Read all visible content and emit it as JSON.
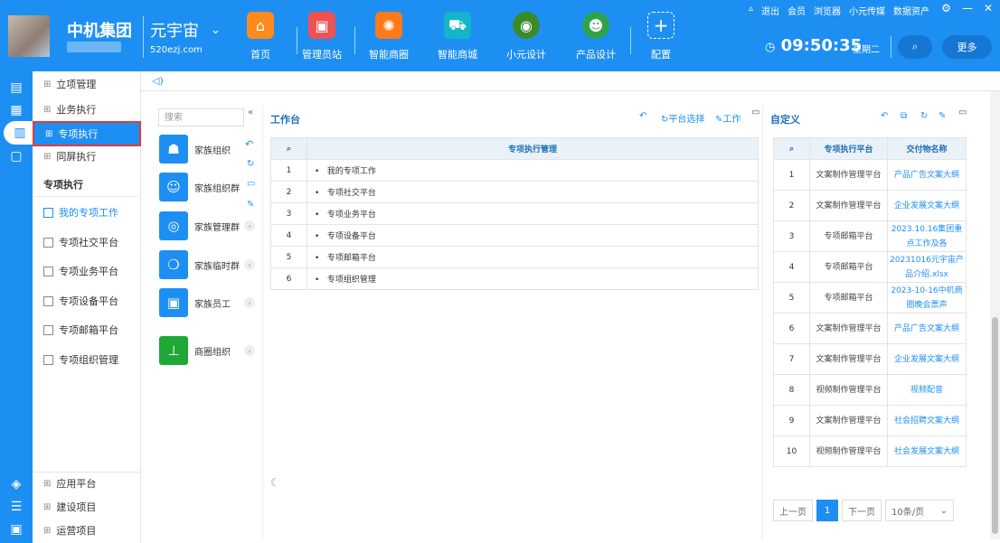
{
  "header": {
    "org_name": "中机集团",
    "brand_name": "元宇宙",
    "brand_url": "520ezj.com",
    "nav": [
      {
        "label": "首页",
        "icon": "home-icon",
        "color": "#ff8a1e"
      },
      {
        "label": "管理员站",
        "icon": "monitor-icon",
        "color": "#f05252"
      },
      {
        "label": "智能商圈",
        "icon": "gear-circle-icon",
        "color": "#ff7a1a"
      },
      {
        "label": "智能商城",
        "icon": "cart-icon",
        "color": "#13b5c9"
      },
      {
        "label": "小元设计",
        "icon": "globe-icon",
        "color": "#3a8a2a"
      },
      {
        "label": "产品设计",
        "icon": "people-icon",
        "color": "#2fa34a"
      },
      {
        "label": "配置",
        "icon": "plus-icon",
        "color": "transparent"
      }
    ],
    "links": [
      "退出",
      "会员",
      "浏览器",
      "小元传媒",
      "数据资产"
    ],
    "time": "09:50:35",
    "weekday": "星期二",
    "more_label": "更多"
  },
  "menu": {
    "top_items": [
      "立项管理",
      "业务执行",
      "专项执行",
      "同屏执行"
    ],
    "section_title": "专项执行",
    "sub_items": [
      "我的专项工作",
      "专项社交平台",
      "专项业务平台",
      "专项设备平台",
      "专项邮箱平台",
      "专项组织管理"
    ],
    "bottom_items": [
      "应用平台",
      "建设项目",
      "运营项目"
    ]
  },
  "family": {
    "search_placeholder": "搜索",
    "items": [
      {
        "label": "家族组织",
        "color": "#1e8ff2",
        "icon": "group-icon"
      },
      {
        "label": "家族组织群",
        "color": "#1e8ff2",
        "icon": "user-icon"
      },
      {
        "label": "家族管理群",
        "color": "#1e8ff2",
        "icon": "broadcast-icon"
      },
      {
        "label": "家族临时群",
        "color": "#1e8ff2",
        "icon": "ring-icon"
      },
      {
        "label": "家族员工",
        "color": "#1e8ff2",
        "icon": "badge-icon"
      },
      {
        "label": "商圈组织",
        "color": "#1fa836",
        "icon": "org-chart-icon"
      }
    ]
  },
  "workbench": {
    "title": "工作台",
    "tool_platform": "平台选择",
    "tool_work": "工作",
    "table_header": "专项执行管理",
    "rows": [
      {
        "no": "1",
        "name": "我的专项工作"
      },
      {
        "no": "2",
        "name": "专项社交平台"
      },
      {
        "no": "3",
        "name": "专项业务平台"
      },
      {
        "no": "4",
        "name": "专项设备平台"
      },
      {
        "no": "5",
        "name": "专项邮箱平台"
      },
      {
        "no": "6",
        "name": "专项组织管理"
      }
    ]
  },
  "custom": {
    "title": "自定义",
    "col_platform": "专项执行平台",
    "col_file": "交付物名称",
    "rows": [
      {
        "no": "1",
        "platform": "文案制作管理平台",
        "file": "产品广告文案大纲"
      },
      {
        "no": "2",
        "platform": "文案制作管理平台",
        "file": "企业发展文案大纲"
      },
      {
        "no": "3",
        "platform": "专项邮箱平台",
        "file": "2023.10.16集团重点工作及各"
      },
      {
        "no": "4",
        "platform": "专项邮箱平台",
        "file": "20231016元宇宙产品介绍.xlsx"
      },
      {
        "no": "5",
        "platform": "专项邮箱平台",
        "file": "2023-10-16中机商圈晚会票声"
      },
      {
        "no": "6",
        "platform": "文案制作管理平台",
        "file": "产品广告文案大纲"
      },
      {
        "no": "7",
        "platform": "文案制作管理平台",
        "file": "企业发展文案大纲"
      },
      {
        "no": "8",
        "platform": "视频制作管理平台",
        "file": "视频配音"
      },
      {
        "no": "9",
        "platform": "文案制作管理平台",
        "file": "社会招聘文案大纲"
      },
      {
        "no": "10",
        "platform": "视频制作管理平台",
        "file": "社会发展文案大纲"
      }
    ],
    "pager": {
      "prev": "上一页",
      "current": "1",
      "next": "下一页",
      "size": "10条/页"
    }
  }
}
